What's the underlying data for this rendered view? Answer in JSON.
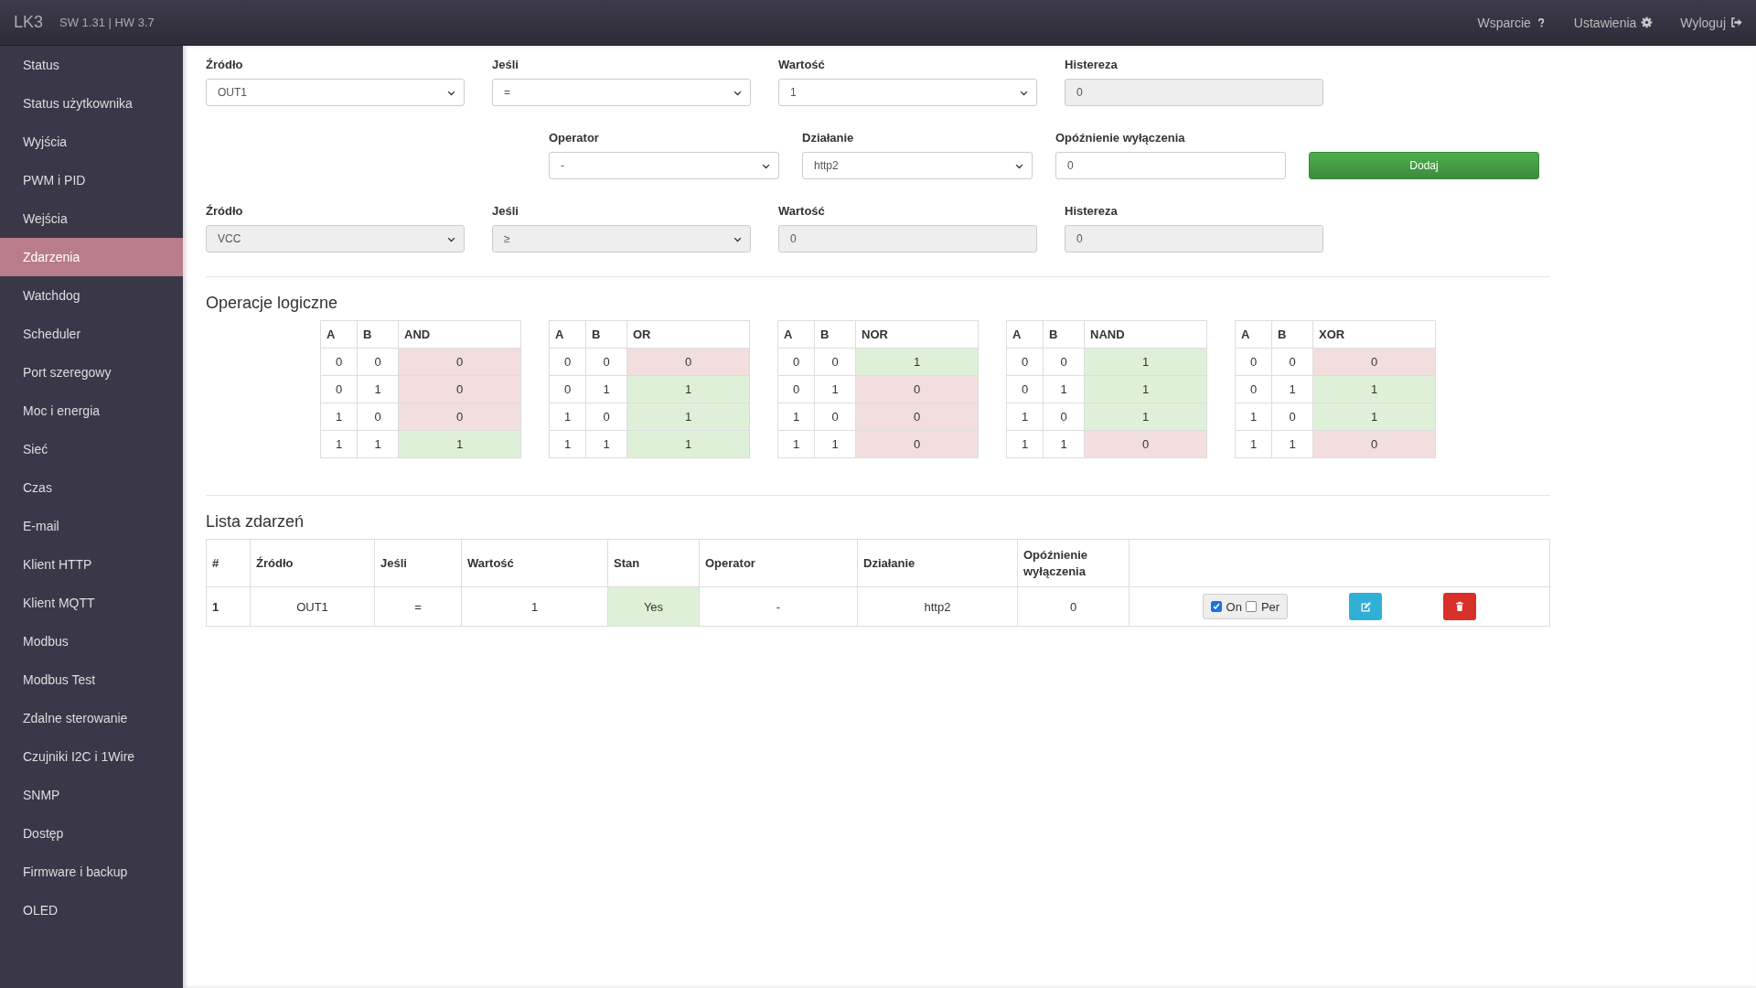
{
  "topbar": {
    "brand": "LK3",
    "version": "SW 1.31 | HW 3.7",
    "links": [
      {
        "label": "Wsparcie",
        "kind": "help"
      },
      {
        "label": "Ustawienia",
        "kind": "settings"
      },
      {
        "label": "Wyloguj",
        "kind": "logout"
      }
    ]
  },
  "sidebar": {
    "items": [
      {
        "label": "Status",
        "selected": false
      },
      {
        "label": "Status użytkownika",
        "selected": false
      },
      {
        "label": "Wyjścia",
        "selected": false
      },
      {
        "label": "PWM i PID",
        "selected": false
      },
      {
        "label": "Wejścia",
        "selected": false
      },
      {
        "label": "Zdarzenia",
        "selected": true
      },
      {
        "label": "Watchdog",
        "selected": false
      },
      {
        "label": "Scheduler",
        "selected": false
      },
      {
        "label": "Port szeregowy",
        "selected": false
      },
      {
        "label": "Moc i energia",
        "selected": false
      },
      {
        "label": "Sieć",
        "selected": false
      },
      {
        "label": "Czas",
        "selected": false
      },
      {
        "label": "E-mail",
        "selected": false
      },
      {
        "label": "Klient HTTP",
        "selected": false
      },
      {
        "label": "Klient MQTT",
        "selected": false
      },
      {
        "label": "Modbus",
        "selected": false
      },
      {
        "label": "Modbus Test",
        "selected": false
      },
      {
        "label": "Zdalne sterowanie",
        "selected": false
      },
      {
        "label": "Czujniki I2C i 1Wire",
        "selected": false
      },
      {
        "label": "SNMP",
        "selected": false
      },
      {
        "label": "Dostęp",
        "selected": false
      },
      {
        "label": "Firmware i backup",
        "selected": false
      },
      {
        "label": "OLED",
        "selected": false
      }
    ]
  },
  "form": {
    "rows": [
      {
        "kind": "condition",
        "fields": [
          {
            "label": "Źródło",
            "kind": "select",
            "value": "OUT1",
            "disabled": false
          },
          {
            "label": "Jeśli",
            "kind": "select",
            "value": "=",
            "disabled": false
          },
          {
            "label": "Wartość",
            "kind": "select",
            "value": "1",
            "disabled": false
          },
          {
            "label": "Histereza",
            "kind": "input",
            "value": "0",
            "disabled": true
          }
        ]
      },
      {
        "kind": "action",
        "fields": [
          {
            "label": "Operator",
            "kind": "select",
            "value": "-",
            "disabled": false
          },
          {
            "label": "Działanie",
            "kind": "select",
            "value": "http2",
            "disabled": false
          },
          {
            "label": "Opóźnienie wyłączenia",
            "kind": "input",
            "value": "0",
            "disabled": false
          }
        ],
        "button": "Dodaj"
      },
      {
        "kind": "condition",
        "fields": [
          {
            "label": "Źródło",
            "kind": "select",
            "value": "VCC",
            "disabled": true
          },
          {
            "label": "Jeśli",
            "kind": "select",
            "value": "≥",
            "disabled": true
          },
          {
            "label": "Wartość",
            "kind": "input",
            "value": "0",
            "disabled": true
          },
          {
            "label": "Histereza",
            "kind": "input",
            "value": "0",
            "disabled": true
          }
        ]
      }
    ]
  },
  "logic": {
    "title": "Operacje logiczne",
    "tables": [
      {
        "columns": [
          "A",
          "B",
          "AND"
        ],
        "rows": [
          {
            "a": "0",
            "b": "0",
            "result": "0",
            "high": false
          },
          {
            "a": "0",
            "b": "1",
            "result": "0",
            "high": false
          },
          {
            "a": "1",
            "b": "0",
            "result": "0",
            "high": false
          },
          {
            "a": "1",
            "b": "1",
            "result": "1",
            "high": true
          }
        ]
      },
      {
        "columns": [
          "A",
          "B",
          "OR"
        ],
        "rows": [
          {
            "a": "0",
            "b": "0",
            "result": "0",
            "high": false
          },
          {
            "a": "0",
            "b": "1",
            "result": "1",
            "high": true
          },
          {
            "a": "1",
            "b": "0",
            "result": "1",
            "high": true
          },
          {
            "a": "1",
            "b": "1",
            "result": "1",
            "high": true
          }
        ]
      },
      {
        "columns": [
          "A",
          "B",
          "NOR"
        ],
        "rows": [
          {
            "a": "0",
            "b": "0",
            "result": "1",
            "high": true
          },
          {
            "a": "0",
            "b": "1",
            "result": "0",
            "high": false
          },
          {
            "a": "1",
            "b": "0",
            "result": "0",
            "high": false
          },
          {
            "a": "1",
            "b": "1",
            "result": "0",
            "high": false
          }
        ]
      },
      {
        "columns": [
          "A",
          "B",
          "NAND"
        ],
        "rows": [
          {
            "a": "0",
            "b": "0",
            "result": "1",
            "high": true
          },
          {
            "a": "0",
            "b": "1",
            "result": "1",
            "high": true
          },
          {
            "a": "1",
            "b": "0",
            "result": "1",
            "high": true
          },
          {
            "a": "1",
            "b": "1",
            "result": "0",
            "high": false
          }
        ]
      },
      {
        "columns": [
          "A",
          "B",
          "XOR"
        ],
        "rows": [
          {
            "a": "0",
            "b": "0",
            "result": "0",
            "high": false
          },
          {
            "a": "0",
            "b": "1",
            "result": "1",
            "high": true
          },
          {
            "a": "1",
            "b": "0",
            "result": "1",
            "high": true
          },
          {
            "a": "1",
            "b": "1",
            "result": "0",
            "high": false
          }
        ]
      }
    ]
  },
  "events": {
    "title": "Lista zdarzeń",
    "columns": [
      "#",
      "Źródło",
      "Jeśli",
      "Wartość",
      "Stan",
      "Operator",
      "Działanie",
      "Opóźnienie wyłączenia"
    ],
    "rows": [
      {
        "number": "1",
        "source": "OUT1",
        "condition": "=",
        "value": "1",
        "state": {
          "text": "Yes",
          "ok": true
        },
        "operator": "-",
        "action": "http2",
        "delay": "0",
        "enabled": {
          "label": "On",
          "checked": true
        },
        "periodic": {
          "label": "Per",
          "checked": false
        }
      }
    ]
  }
}
